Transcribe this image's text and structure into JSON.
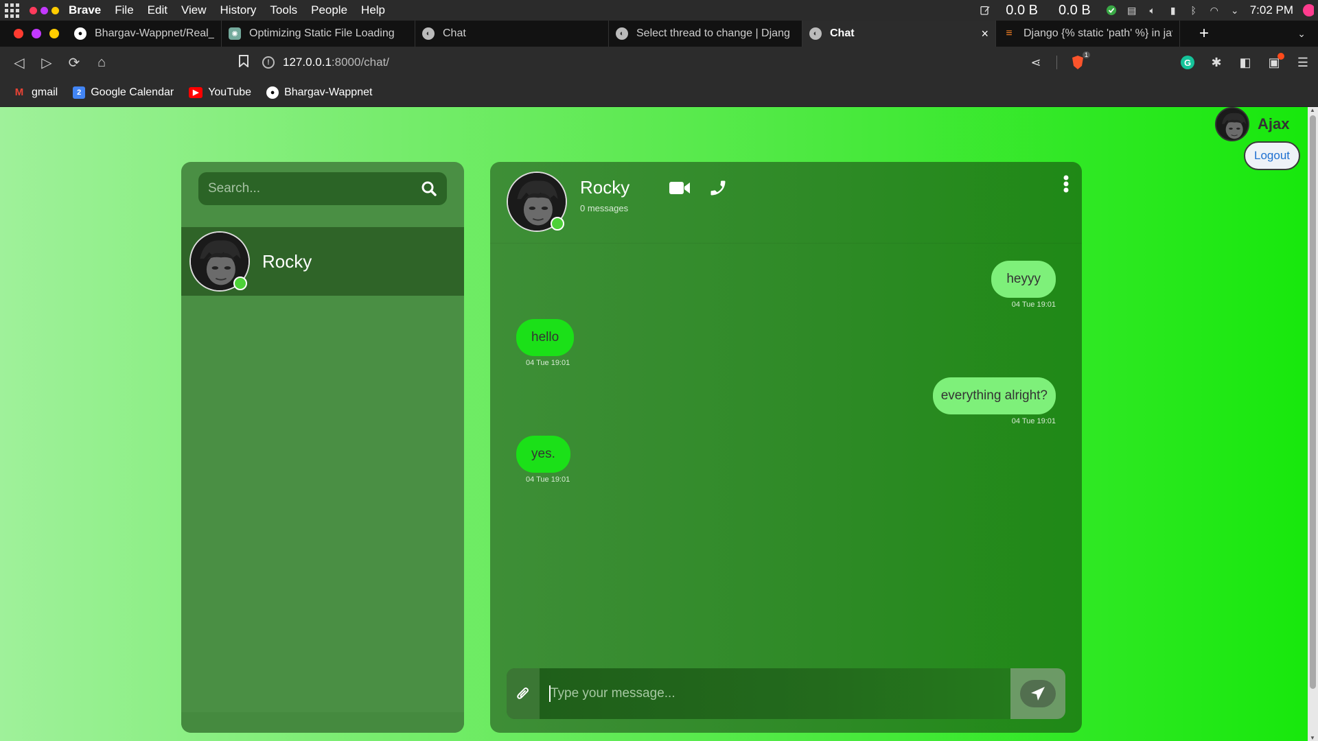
{
  "os_bar": {
    "app_name": "Brave",
    "menu": [
      "File",
      "Edit",
      "View",
      "History",
      "Tools",
      "People",
      "Help"
    ],
    "net_up": "0.0 B",
    "net_down": "0.0 B",
    "clock": "7:02 PM"
  },
  "tabs": [
    {
      "title": "Bhargav-Wappnet/Real_Time_C",
      "icon": "github-icon",
      "active": false
    },
    {
      "title": "Optimizing Static File Loading",
      "icon": "chatgpt-icon",
      "active": false
    },
    {
      "title": "Chat",
      "icon": "globe-icon",
      "active": false
    },
    {
      "title": "Select thread to change | Djang",
      "icon": "globe-icon",
      "active": false
    },
    {
      "title": "Chat",
      "icon": "globe-icon",
      "active": true
    },
    {
      "title": "Django {% static 'path' %} in jav",
      "icon": "stackoverflow-icon",
      "active": false
    }
  ],
  "tab_close_glyph": "×",
  "new_tab_glyph": "+",
  "address_bar": {
    "url_host": "127.0.0.1",
    "url_path": ":8000/chat/",
    "shields_count": "1"
  },
  "bookmarks": [
    {
      "label": "gmail",
      "icon": "gmail-icon"
    },
    {
      "label": "Google Calendar",
      "icon": "calendar-icon"
    },
    {
      "label": "YouTube",
      "icon": "youtube-icon"
    },
    {
      "label": "Bhargav-Wappnet",
      "icon": "github-icon"
    }
  ],
  "user": {
    "name": "Ajax",
    "logout_label": "Logout"
  },
  "sidebar": {
    "search_placeholder": "Search...",
    "contacts": [
      {
        "name": "Rocky",
        "online": true
      }
    ]
  },
  "chat": {
    "contact_name": "Rocky",
    "message_count": "0 messages",
    "messages": [
      {
        "text": "heyyy",
        "time": "04 Tue 19:01",
        "direction": "sent"
      },
      {
        "text": "hello",
        "time": "04 Tue 19:01",
        "direction": "received"
      },
      {
        "text": "everything alright?",
        "time": "04 Tue 19:01",
        "direction": "sent"
      },
      {
        "text": "yes.",
        "time": "04 Tue 19:01",
        "direction": "received"
      }
    ],
    "composer_placeholder": "Type your message..."
  },
  "colors": {
    "sent_bubble": "#7ef07a",
    "received_bubble": "#1be018",
    "online_dot": "#4cd137",
    "page_gradient_start": "#9ff19a",
    "page_gradient_end": "#16e80b"
  }
}
